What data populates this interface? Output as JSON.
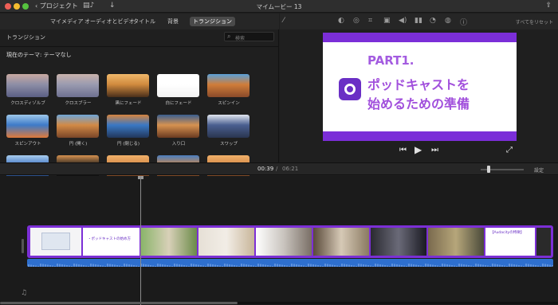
{
  "titlebar": {
    "back_label": "プロジェクト",
    "title": "マイムービー 13",
    "film_icon": "film-icon",
    "download_icon": "download-arrow-icon",
    "share_icon": "share-icon"
  },
  "media_tabs": {
    "items": [
      "マイメディア",
      "オーディオとビデオ",
      "タイトル",
      "背景",
      "トランジション"
    ],
    "active": "トランジション"
  },
  "toolbar": {
    "tools": [
      "magic-wand-icon",
      "color-balance-icon",
      "color-correction-icon",
      "crop-icon",
      "stabilization-icon",
      "volume-icon",
      "noise-reduction-icon",
      "speed-icon",
      "clip-filter-icon",
      "info-icon"
    ],
    "reset_label": "すべてをリセット"
  },
  "browser": {
    "title": "トランジション",
    "search_placeholder": "検索",
    "theme_label": "現在のテーマ: テーマなし",
    "transitions": [
      {
        "label": "クロスディゾルブ",
        "colors": [
          "#8d8ea6",
          "#c8a8a0",
          "#5b5f84"
        ]
      },
      {
        "label": "クロスブラー",
        "colors": [
          "#9a9bb0",
          "#c9b2ab",
          "#6e7090"
        ]
      },
      {
        "label": "黒にフェード",
        "colors": [
          "#d08a3e",
          "#f0b86a",
          "#4a2f1a"
        ]
      },
      {
        "label": "白にフェード",
        "colors": [
          "#ffffff",
          "#ffffff",
          "#f2f2f2"
        ]
      },
      {
        "label": "スピンイン",
        "colors": [
          "#d07d3a",
          "#5aa0d8",
          "#8a4a2a"
        ]
      },
      {
        "label": "スピンアウト",
        "colors": [
          "#3d7ac8",
          "#9ec8ea",
          "#e07a3a"
        ]
      },
      {
        "label": "円 (開く)",
        "colors": [
          "#d28a46",
          "#6fa6d8",
          "#7a4628"
        ]
      },
      {
        "label": "円 (閉じる)",
        "colors": [
          "#3a78c4",
          "#d6843e",
          "#22375a"
        ]
      },
      {
        "label": "入り口",
        "colors": [
          "#d69250",
          "#3a5f90",
          "#6a3a20"
        ]
      },
      {
        "label": "スワップ",
        "colors": [
          "#4a5f90",
          "#e1e6ef",
          "#2a3550"
        ]
      },
      {
        "label": "",
        "colors": [
          "#3f73c0",
          "#a9cdee",
          "#2a4a80"
        ]
      },
      {
        "label": "",
        "colors": [
          "#1a1a1a",
          "#d69250",
          "#101010"
        ]
      },
      {
        "label": "",
        "colors": [
          "#d28846",
          "#f0b06a",
          "#6a3a20"
        ]
      },
      {
        "label": "",
        "colors": [
          "#d28846",
          "#4a7ec0",
          "#6a3a20"
        ]
      },
      {
        "label": "",
        "colors": [
          "#d28846",
          "#f0b06a",
          "#6a3a20"
        ]
      }
    ]
  },
  "viewer": {
    "slide_part": "PART1.",
    "slide_line1": "ポッドキャストを",
    "slide_line2": "始めるための準備"
  },
  "timecode": {
    "current": "00:39",
    "separator": "/",
    "total": "06:21",
    "settings_label": "設定"
  },
  "timeline": {
    "clip_texts": [
      "・ポッドキャストの始め方",
      "【Audacityの特徴】"
    ]
  },
  "colors": {
    "accent_purple": "#7c2fd6",
    "audio_blue": "#2e6fce"
  }
}
